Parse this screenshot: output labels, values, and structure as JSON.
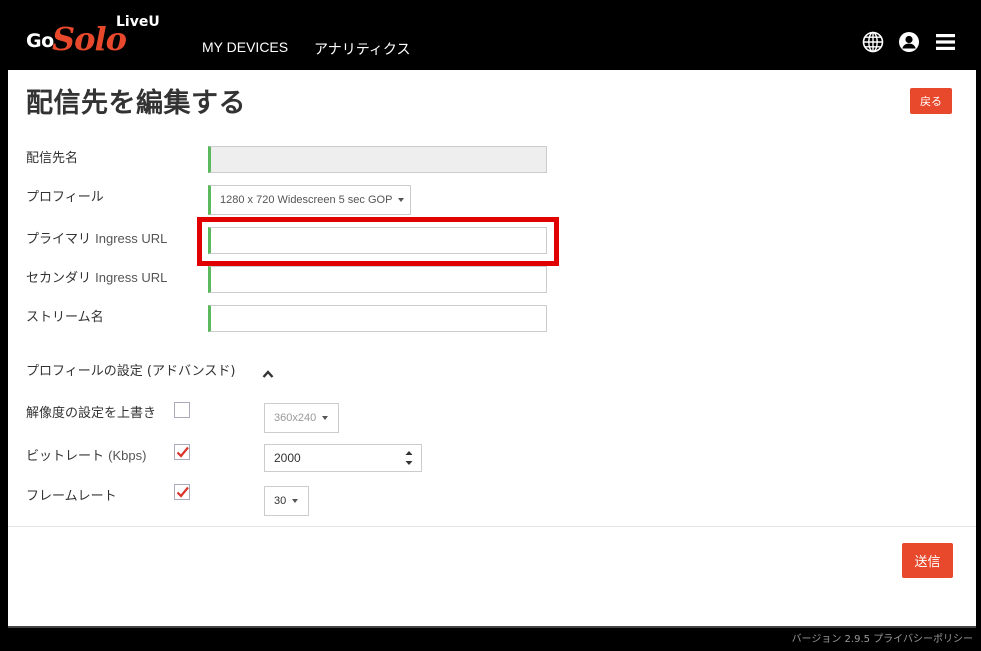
{
  "brand": {
    "part1": "Go",
    "part2": "Solo",
    "part3": "LiveU"
  },
  "nav": {
    "devices": "MY DEVICES",
    "analytics": "アナリティクス"
  },
  "icons": {
    "language": "globe-icon",
    "account": "user-icon",
    "menu": "hamburger-menu-icon"
  },
  "page": {
    "title": "配信先を編集する",
    "back_label": "戻る"
  },
  "form": {
    "destination_name": {
      "label": "配信先名",
      "value": ""
    },
    "profile": {
      "label": "プロフィール",
      "value": "1280 x 720 Widescreen 5 sec GOP"
    },
    "primary_url": {
      "label_jp": "プライマリ",
      "label_en": "Ingress URL",
      "value": ""
    },
    "secondary_url": {
      "label_jp": "セカンダリ",
      "label_en": "Ingress URL",
      "value": ""
    },
    "stream_name": {
      "label": "ストリーム名",
      "value": ""
    }
  },
  "advanced": {
    "title_jp": "プロフィールの設定",
    "title_paren": "(アドバンスド)",
    "resolution": {
      "label": "解像度の設定を上書き",
      "checked": false,
      "value": "360x240"
    },
    "bitrate": {
      "label_jp": "ビットレート",
      "label_en": "(Kbps)",
      "checked": true,
      "value": "2000"
    },
    "framerate": {
      "label": "フレームレート",
      "checked": true,
      "value": "30"
    }
  },
  "actions": {
    "submit_label": "送信"
  },
  "footer": {
    "version": "バージョン 2.9.5",
    "privacy": "プライバシーポリシー"
  },
  "colors": {
    "accent": "#e8482b",
    "valid": "#5cb85c",
    "highlight": "#e00000",
    "check": "#d9342b"
  }
}
